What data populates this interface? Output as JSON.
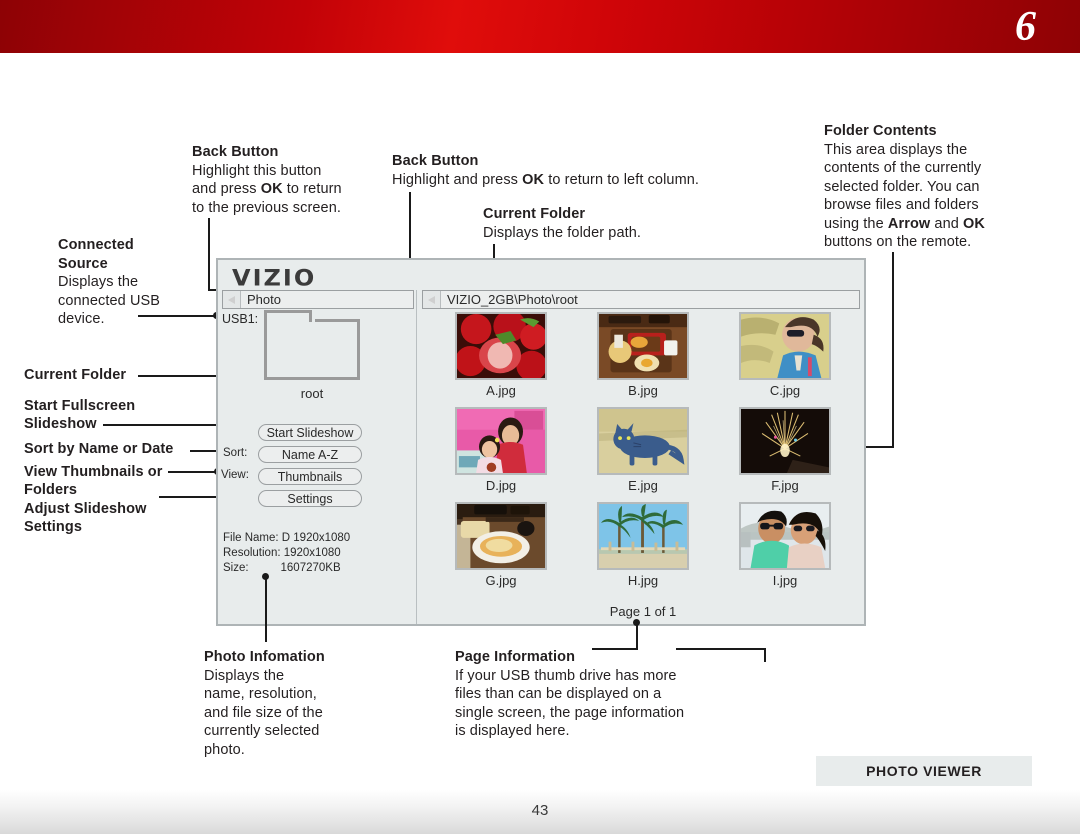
{
  "header": {
    "chapter_number": "6"
  },
  "footer": {
    "section_tab": "PHOTO VIEWER",
    "page_number": "43"
  },
  "callouts": {
    "back_button_left": {
      "title": "Back Button",
      "line1": "Highlight this button",
      "line2a": "and press ",
      "line2b": "OK",
      "line2c": " to return",
      "line3": "to the previous screen."
    },
    "back_button_right": {
      "title": "Back Button",
      "line1a": "Highlight and press ",
      "line1b": "OK",
      "line1c": " to return to left column."
    },
    "current_folder_top": {
      "title": "Current Folder",
      "line1": "Displays the folder path."
    },
    "folder_contents": {
      "title": "Folder Contents",
      "line1": "This area displays the",
      "line2": "contents of the currently",
      "line3": "selected folder. You can",
      "line4": "browse files and folders",
      "line5a": "using the ",
      "line5b": "Arrow",
      "line5c": " and ",
      "line5d": "OK",
      "line6": "buttons on the remote."
    },
    "connected_source": {
      "title1": "Connected",
      "title2": "Source",
      "line1": "Displays the",
      "line2": "connected USB",
      "line3": "device."
    },
    "photo_information": {
      "title": "Photo Infomation",
      "line1": "Displays the",
      "line2": "name, resolution,",
      "line3": "and file size of the",
      "line4": "currently selected",
      "line5": "photo."
    },
    "page_information": {
      "title": "Page Information",
      "line1": "If your USB thumb drive has more",
      "line2": "files than can be displayed on a",
      "line3": "single screen, the page information",
      "line4": "is displayed here."
    }
  },
  "left_labels": {
    "current_folder": "Current Folder",
    "start_fullscreen_1": "Start Fullscreen",
    "start_fullscreen_2": "Slideshow",
    "sort_by": "Sort by Name or Date",
    "view_thumbs_1": "View Thumbnails or",
    "view_thumbs_2": "Folders",
    "adjust_1": "Adjust Slideshow",
    "adjust_2": "Settings"
  },
  "screen": {
    "brand": "VIZIO",
    "breadcrumb_left": "Photo",
    "breadcrumb_right": "VIZIO_2GB\\Photo\\root",
    "source_label": "USB1:",
    "folder_name": "root",
    "controls": {
      "start_slideshow": "Start Slideshow",
      "sort_label": "Sort:",
      "sort_value": "Name A-Z",
      "view_label": "View:",
      "view_value": "Thumbnails",
      "settings": "Settings"
    },
    "file_info": {
      "file_name": "File Name: D 1920x1080",
      "resolution": "Resolution: 1920x1080",
      "size": "Size:          1607270KB"
    },
    "page_indicator": "Page 1 of 1",
    "thumbnails": [
      {
        "caption": "A.jpg",
        "subject": "strawberries"
      },
      {
        "caption": "B.jpg",
        "subject": "food-tray"
      },
      {
        "caption": "C.jpg",
        "subject": "woman-sunglasses"
      },
      {
        "caption": "D.jpg",
        "subject": "two-girls"
      },
      {
        "caption": "E.jpg",
        "subject": "blue-cat"
      },
      {
        "caption": "F.jpg",
        "subject": "fireworks"
      },
      {
        "caption": "G.jpg",
        "subject": "pasta-dish"
      },
      {
        "caption": "H.jpg",
        "subject": "palm-trees"
      },
      {
        "caption": "I.jpg",
        "subject": "couple-selfie"
      }
    ]
  },
  "colors": {
    "banner_red": "#c20207",
    "panel_bg": "#e8ecec",
    "panel_border": "#aeb4b6",
    "text": "#231f20"
  }
}
